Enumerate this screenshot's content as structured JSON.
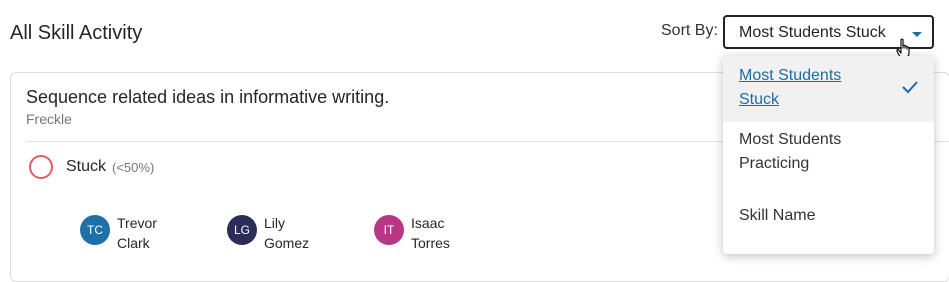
{
  "header": {
    "title": "All Skill Activity",
    "sort_label": "Sort By:",
    "sort_value": "Most Students Stuck"
  },
  "sort_options": [
    {
      "line1": "Most Students",
      "line2": "Stuck",
      "selected": true
    },
    {
      "line1": "Most Students",
      "line2": "Practicing",
      "selected": false
    },
    {
      "line1": "Skill Name",
      "line2": "",
      "selected": false
    }
  ],
  "skill_card": {
    "title": "Sequence related ideas in informative writing.",
    "source": "Freckle",
    "status": {
      "label": "Stuck",
      "threshold": "(<50%)"
    },
    "students": [
      {
        "initials": "TC",
        "first": "Trevor",
        "last": "Clark",
        "color": "#1f6fa8"
      },
      {
        "initials": "LG",
        "first": "Lily",
        "last": "Gomez",
        "color": "#2c2c5a"
      },
      {
        "initials": "IT",
        "first": "Isaac",
        "last": "Torres",
        "color": "#b93586"
      }
    ]
  },
  "colors": {
    "accent": "#1a6ea3",
    "stuck": "#e25a66"
  },
  "icons": {
    "caret": "caret-down-icon",
    "check": "check-icon",
    "cursor": "hand-cursor-icon"
  }
}
